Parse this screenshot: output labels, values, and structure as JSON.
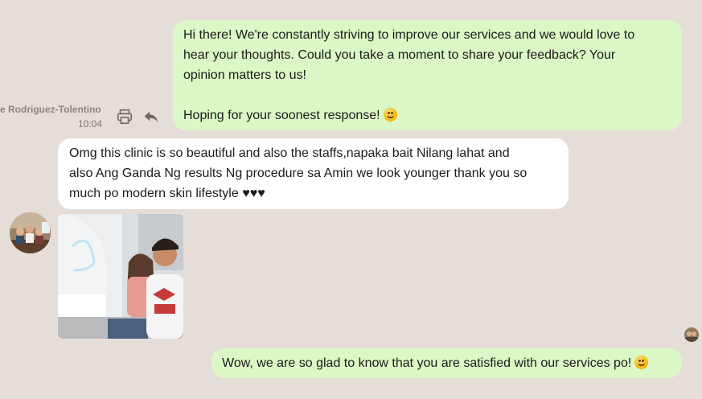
{
  "messages": {
    "outgoing_1": {
      "line1": "Hi there! We're constantly striving to improve our services and we would love to",
      "line2": "hear your thoughts. Could you take a moment to share your feedback? Your",
      "line3": "opinion matters to us!",
      "line4": "Hoping for your soonest response!",
      "emoji": "smiling-face-icon"
    },
    "sender": {
      "name": "e Rodriguez-Tolentino",
      "time": "10:04"
    },
    "incoming_1": {
      "line1": "Omg this clinic is so beautiful and also the staffs,napaka bait Nilang lahat and",
      "line2": "also Ang Ganda Ng results Ng procedure sa Amin we look younger thank you so",
      "line3": "much po modern skin lifestyle ♥♥♥"
    },
    "outgoing_2": {
      "text": "Wow, we are so glad to know that you are satisfied with our services po!",
      "emoji": "smiling-face-icon"
    }
  },
  "icons": {
    "print": "print-icon",
    "reply": "reply-icon",
    "sender_avatar": "avatar",
    "own_avatar": "avatar"
  },
  "colors": {
    "background": "#e5ddd8",
    "outgoing_bubble": "#dbf7c5",
    "incoming_bubble": "#ffffff"
  }
}
